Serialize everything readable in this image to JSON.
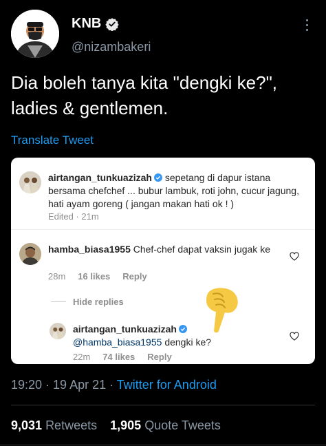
{
  "tweet": {
    "author": {
      "display_name": "KNB",
      "handle": "@nizambakeri",
      "verified": true,
      "avatar_icon": "profile-photo-masked-man"
    },
    "text": "Dia boleh tanya kita \"dengki ke?\",\nladies & gentlemen.",
    "translate_label": "Translate Tweet",
    "time": "19:20",
    "date": "19 Apr 21",
    "source": "Twitter for Android",
    "retweets_count": "9,031",
    "retweets_label": "Retweets",
    "quotes_count": "1,905",
    "quotes_label": "Quote Tweets"
  },
  "colors": {
    "background": "#000000",
    "accent": "#1d9bf0",
    "secondary_text": "#8b98a5",
    "ig_mention": "#00376b",
    "emoji": "#f6c945"
  },
  "attached_image": {
    "caption": {
      "username": "airtangan_tunkuazizah",
      "text": "sepetang di dapur istana bersama chefchef ... bubur lambuk, roti john, cucur jagung, hati ayam goreng ( jangan makan hati ok ! )",
      "meta": "Edited · 21m"
    },
    "comment": {
      "username": "hamba_biasa1955",
      "text": "Chef-chef dapat vaksin jugak ke",
      "time": "28m",
      "likes": "16 likes",
      "reply_label": "Reply"
    },
    "hide_replies_label": "Hide replies",
    "reply": {
      "username": "airtangan_tunkuazizah",
      "mention": "@hamba_biasa1955",
      "text": "dengki ke?",
      "time": "22m",
      "likes": "74 likes",
      "reply_label": "Reply"
    },
    "emoji_icon": "pointing-down-hand-emoji"
  }
}
